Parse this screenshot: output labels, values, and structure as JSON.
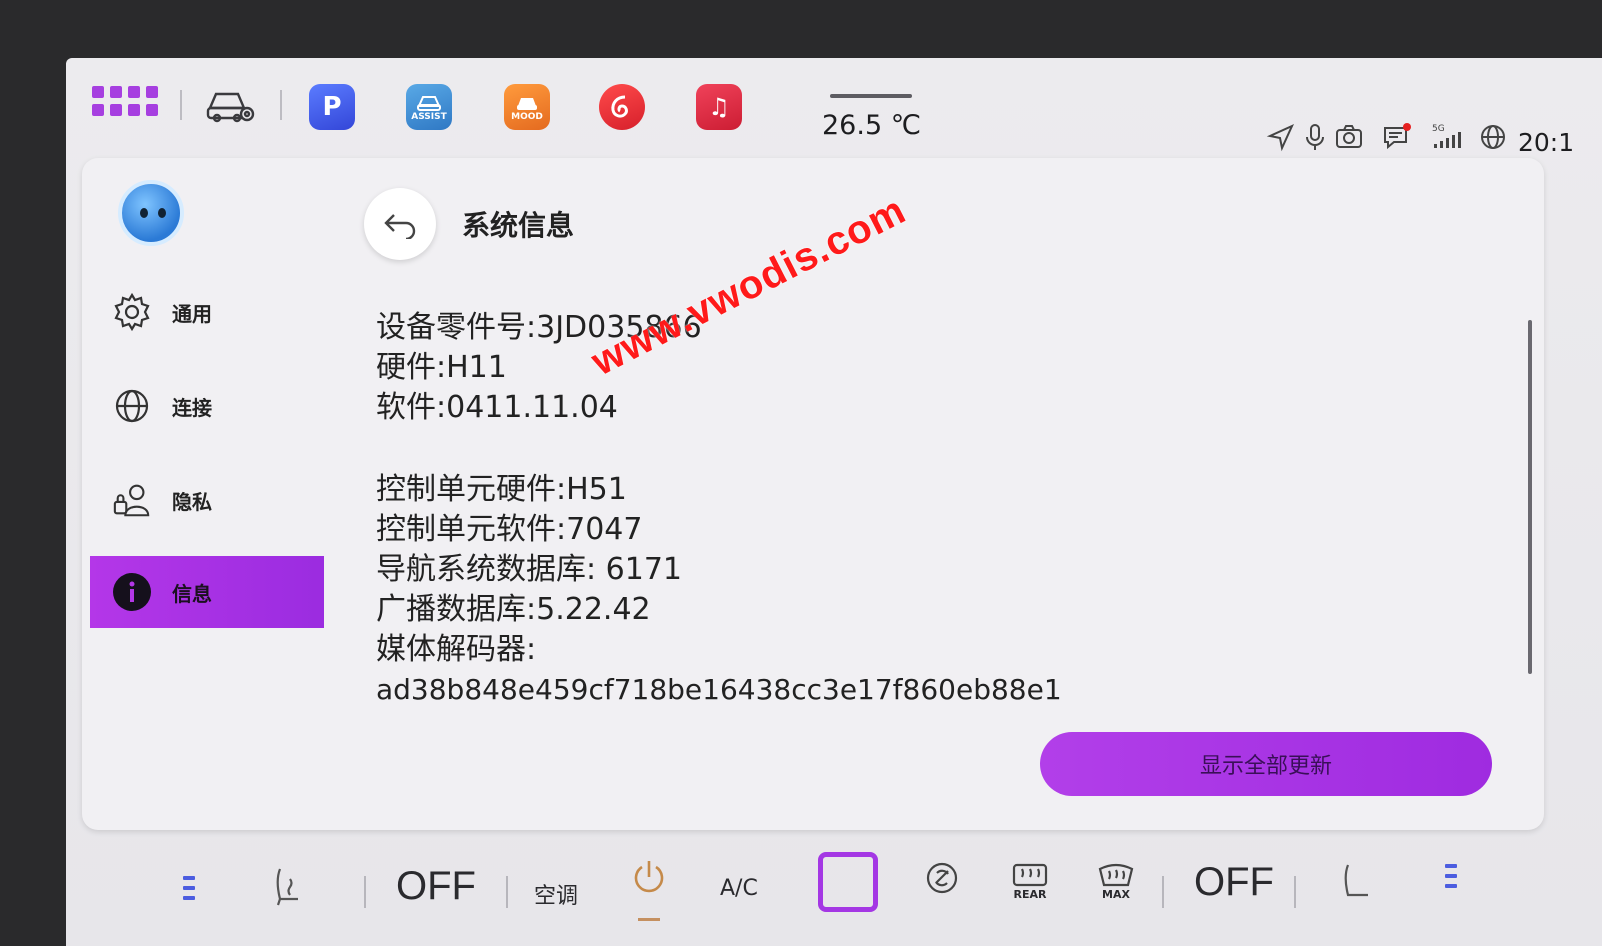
{
  "status_bar": {
    "temperature": "26.5 ℃",
    "clock": "20:1",
    "apps": [
      {
        "name": "parking",
        "label": "P",
        "color": "#4058e8"
      },
      {
        "name": "assist",
        "label": "ASSIST",
        "color": "#3f8fd6"
      },
      {
        "name": "mood",
        "label": "MOOD",
        "color": "#f07d2c"
      },
      {
        "name": "netease-music",
        "label": "",
        "color": "#e63036"
      },
      {
        "name": "music",
        "label": "♫",
        "color": "#de2b43"
      }
    ],
    "signal": "5G"
  },
  "sidebar": {
    "items": [
      {
        "label": "通用",
        "icon": "gear-icon",
        "active": false
      },
      {
        "label": "连接",
        "icon": "globe-icon",
        "active": false
      },
      {
        "label": "隐私",
        "icon": "privacy-icon",
        "active": false
      },
      {
        "label": "信息",
        "icon": "info-icon",
        "active": true
      }
    ]
  },
  "page": {
    "title": "系统信息",
    "info_group_1": [
      "设备零件号:3JD035866",
      "硬件:H11",
      "软件:0411.11.04"
    ],
    "info_group_2": [
      "控制单元硬件:H51",
      "控制单元软件:7047",
      "导航系统数据库: 6171",
      "广播数据库:5.22.42",
      "媒体解码器:",
      "ad38b848e459cf718be16438cc3e17f860eb88e1"
    ],
    "show_all_button": "显示全部更新"
  },
  "watermark": "www.vwodis.com",
  "climate_bar": {
    "left_fan": "OFF",
    "ac_label": "空调",
    "ac_button": "A/C",
    "right_fan": "OFF",
    "rear_label": "REAR",
    "max_label": "MAX"
  },
  "colors": {
    "accent": "#a437e4",
    "background": "#ecebee",
    "watermark": "#ff1a1a"
  }
}
